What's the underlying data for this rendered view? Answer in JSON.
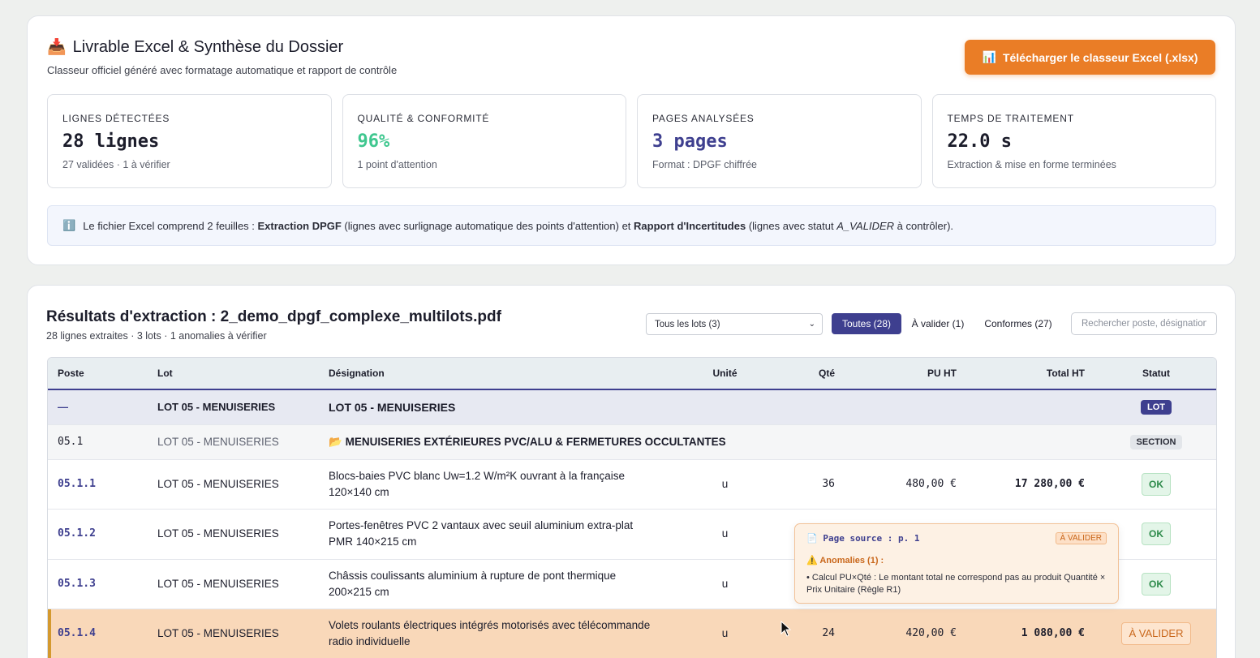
{
  "summary": {
    "icon": "inbox-tray-icon",
    "title": "Livrable Excel & Synthèse du Dossier",
    "subtitle": "Classeur officiel généré avec formatage automatique et rapport de contrôle",
    "download_icon": "chart-icon",
    "download_label": "Télécharger le classeur Excel (.xlsx)",
    "stats": [
      {
        "label": "LIGNES DÉTECTÉES",
        "value": "28 lignes",
        "note": "27 validées · 1 à vérifier"
      },
      {
        "label": "QUALITÉ & CONFORMITÉ",
        "value": "96%",
        "note": "1 point d'attention"
      },
      {
        "label": "PAGES ANALYSÉES",
        "value": "3 pages",
        "note": "Format : DPGF chiffrée"
      },
      {
        "label": "TEMPS DE TRAITEMENT",
        "value": "22.0 s",
        "note": "Extraction & mise en forme terminées"
      }
    ],
    "info": {
      "icon": "info-icon",
      "t1": "Le fichier Excel comprend 2 feuilles : ",
      "b1": "Extraction DPGF",
      "t2": " (lignes avec surlignage automatique des points d'attention) et ",
      "b2": "Rapport d'Incertitudes",
      "t3": " (lignes avec statut ",
      "i1": "A_VALIDER",
      "t4": " à contrôler)."
    }
  },
  "results": {
    "title": "Résultats d'extraction : 2_demo_dpgf_complexe_multilots.pdf",
    "subtitle": "28 lignes extraites · 3 lots · 1 anomalies à vérifier",
    "lot_select": "Tous les lots (3)",
    "filters": {
      "all": "Toutes (28)",
      "to_validate": "À valider (1)",
      "compliant": "Conformes (27)"
    },
    "search_placeholder": "Rechercher poste, désignation...",
    "columns": [
      "Poste",
      "Lot",
      "Désignation",
      "Unité",
      "Qté",
      "PU HT",
      "Total HT",
      "Statut"
    ],
    "lot_row": {
      "poste": "—",
      "lot": "LOT 05 - MENUISERIES",
      "designation": "LOT 05 - MENUISERIES",
      "status": "LOT"
    },
    "section_row": {
      "poste": "05.1",
      "lot": "LOT 05 - MENUISERIES",
      "icon": "folder-open-icon",
      "designation": "MENUISERIES EXTÉRIEURES PVC/ALU & FERMETURES OCCULTANTES",
      "status": "SECTION"
    },
    "rows": [
      {
        "poste": "05.1.1",
        "lot": "LOT 05 - MENUISERIES",
        "designation": "Blocs-baies PVC blanc Uw=1.2 W/m²K ouvrant à la française 120×140 cm",
        "unit": "u",
        "qty": "36",
        "pu": "480,00 €",
        "total": "17 280,00 €",
        "status": "OK"
      },
      {
        "poste": "05.1.2",
        "lot": "LOT 05 - MENUISERIES",
        "designation": "Portes-fenêtres PVC 2 vantaux avec seuil aluminium extra-plat PMR 140×215 cm",
        "unit": "u",
        "qty": "",
        "pu": "",
        "total": "",
        "status": "OK"
      },
      {
        "poste": "05.1.3",
        "lot": "LOT 05 - MENUISERIES",
        "designation": "Châssis coulissants aluminium à rupture de pont thermique 200×215 cm",
        "unit": "u",
        "qty": "",
        "pu": "",
        "total": "",
        "status": "OK"
      },
      {
        "poste": "05.1.4",
        "lot": "LOT 05 - MENUISERIES",
        "designation": "Volets roulants électriques intégrés motorisés avec télécommande radio individuelle",
        "unit": "u",
        "qty": "24",
        "pu": "420,00 €",
        "total": "1 080,00 €",
        "status": "À VALIDER"
      }
    ],
    "tooltip": {
      "icon": "page-icon",
      "source": "Page source : p. 1",
      "badge": "À VALIDER",
      "anomalies_icon": "warning-icon",
      "anomalies_title": "Anomalies (1) :",
      "anomaly_text": "• Calcul PU×Qté : Le montant total ne correspond pas au produit Quantité × Prix Unitaire (Règle R1)"
    }
  },
  "colors": {
    "accent": "#3e3f8f",
    "download": "#ea7d26",
    "ok": "#2c8a49",
    "warning": "#c9671b"
  }
}
